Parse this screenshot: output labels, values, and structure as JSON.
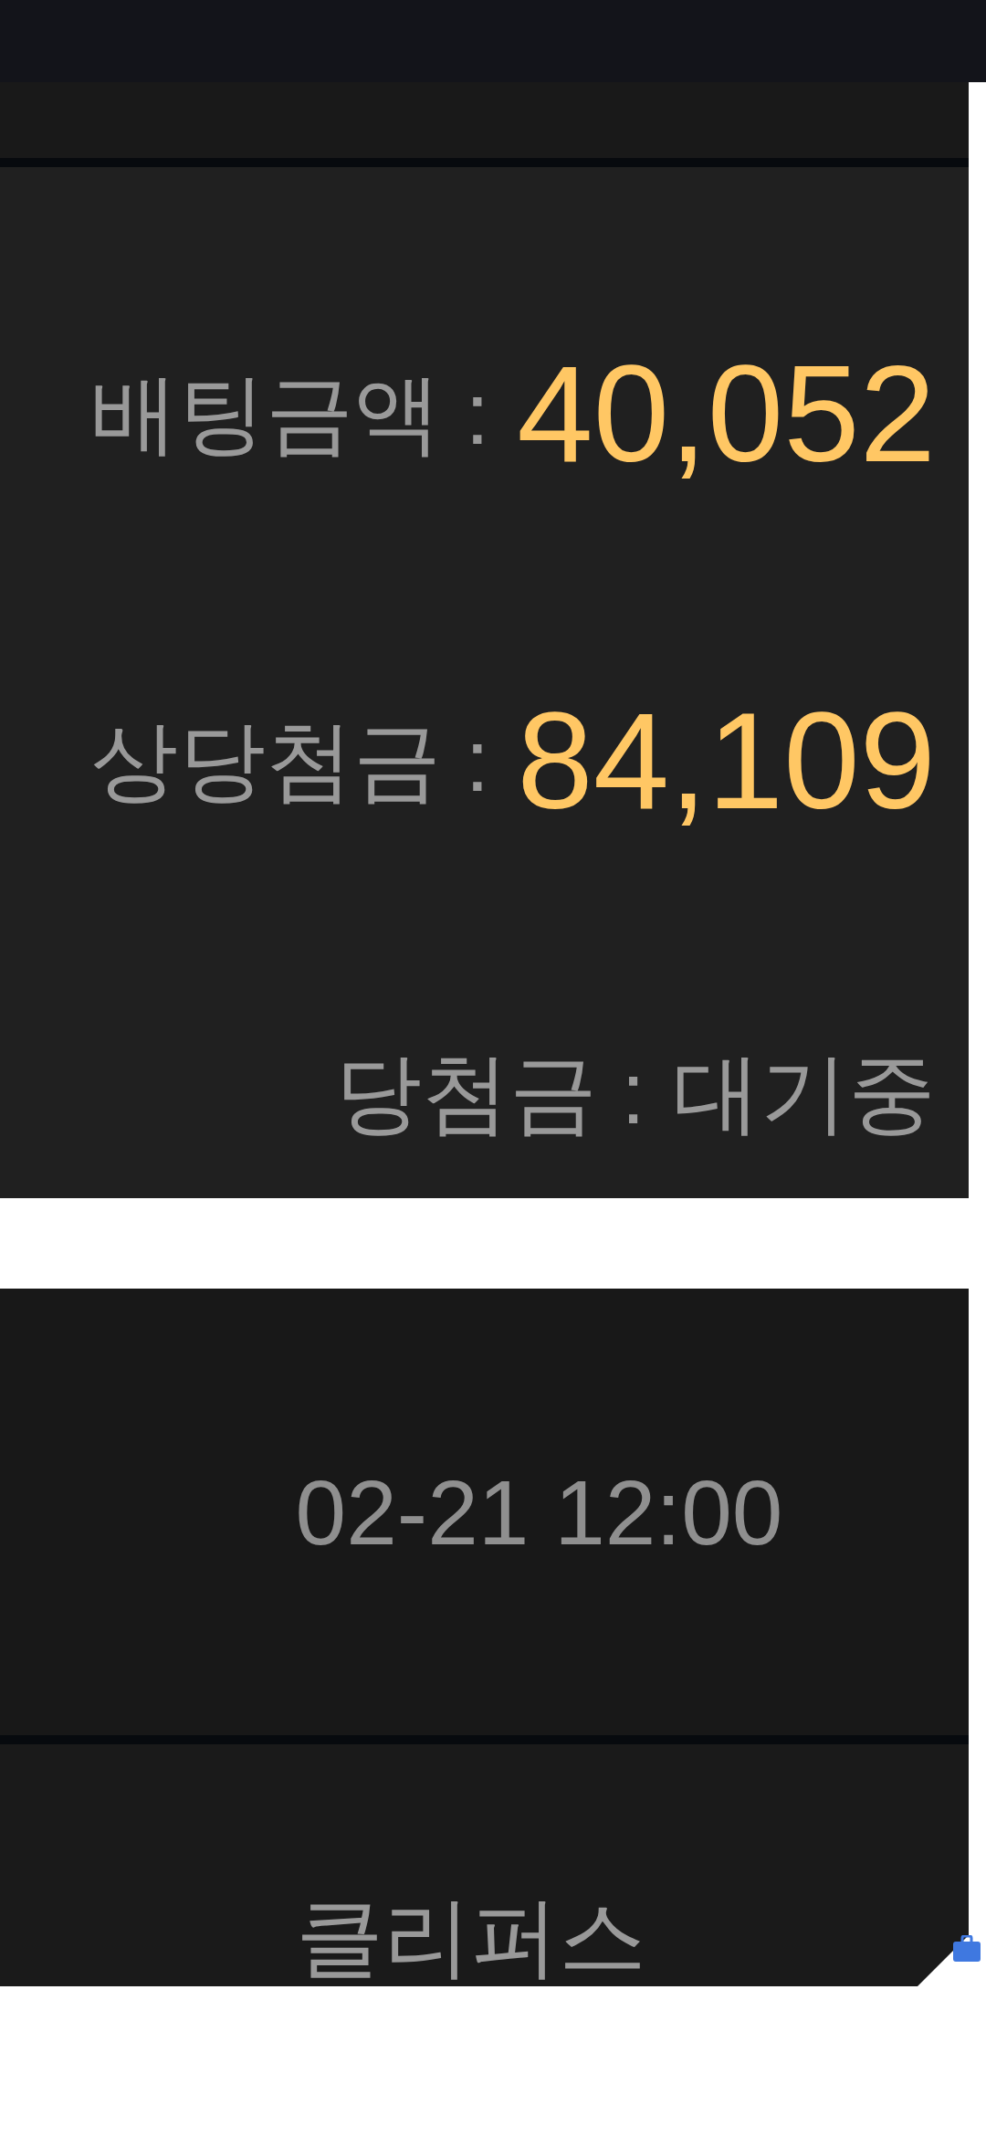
{
  "bet_card": {
    "rows": [
      {
        "kind": "amount",
        "label": "배팅금액 :",
        "value": "40,052"
      },
      {
        "kind": "amount",
        "label": "상당첨금 :",
        "value": "84,109"
      },
      {
        "kind": "status",
        "label": "당첨금 :",
        "value": "대기중"
      }
    ]
  },
  "game_card": {
    "time": "02-21 12:00",
    "team": "클리퍼스"
  }
}
